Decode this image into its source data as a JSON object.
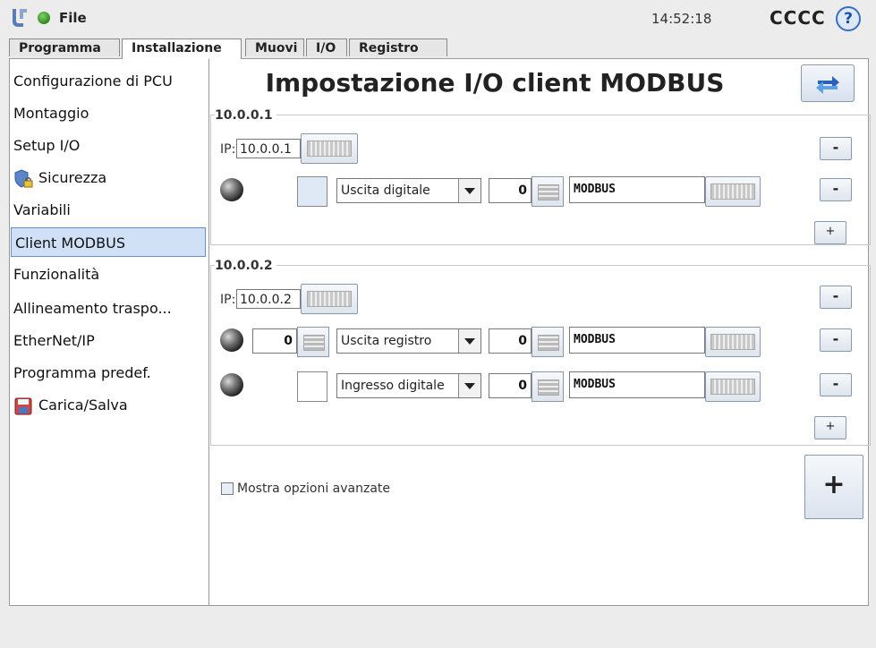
{
  "topbar": {
    "file_label": "File",
    "time": "14:52:18",
    "robot_name": "CCCC",
    "help_label": "?"
  },
  "tabs": [
    {
      "label": "Programma"
    },
    {
      "label": "Installazione"
    },
    {
      "label": "Muovi"
    },
    {
      "label": "I/O"
    },
    {
      "label": "Registro"
    }
  ],
  "sidebar": {
    "items": [
      {
        "label": "Configurazione di PCU"
      },
      {
        "label": "Montaggio"
      },
      {
        "label": "Setup I/O"
      },
      {
        "label": "Sicurezza"
      },
      {
        "label": "Variabili"
      },
      {
        "label": "Client MODBUS"
      },
      {
        "label": "Funzionalità"
      },
      {
        "label": "Allineamento traspo..."
      },
      {
        "label": "EtherNet/IP"
      },
      {
        "label": "Programma predef."
      },
      {
        "label": "Carica/Salva"
      }
    ]
  },
  "main": {
    "title": "Impostazione I/O client MODBUS",
    "groups": [
      {
        "title": "10.0.0.1",
        "ip_label": "IP:",
        "ip_value": "10.0.0.1",
        "signals": [
          {
            "address_value": "",
            "type": "Uscita digitale",
            "register": "0",
            "name": "MODBUS"
          }
        ]
      },
      {
        "title": "10.0.0.2",
        "ip_label": "IP:",
        "ip_value": "10.0.0.2",
        "signals": [
          {
            "address_value": "0",
            "type": "Uscita registro",
            "register": "0",
            "name": "MODBUS"
          },
          {
            "address_value": "",
            "type": "Ingresso digitale",
            "register": "0",
            "name": "MODBUS"
          }
        ]
      }
    ],
    "minus_label": "-",
    "plus_label": "+",
    "advanced_label": "Mostra opzioni avanzate",
    "add_unit_label": "+"
  }
}
